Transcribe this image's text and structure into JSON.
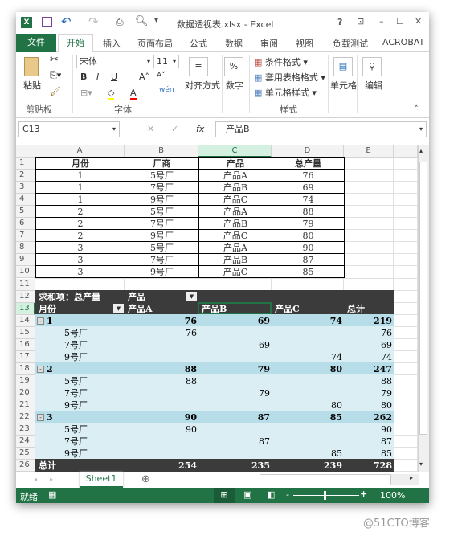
{
  "window": {
    "title": "数据透视表.xlsx - Excel",
    "help": "?",
    "minimize": "–",
    "maximize": "☐",
    "close": "✕"
  },
  "ribbon_tabs": [
    "文件",
    "开始",
    "插入",
    "页面布局",
    "公式",
    "数据",
    "审阅",
    "视图",
    "负载测试",
    "ACROBAT"
  ],
  "ribbon": {
    "paste": "粘贴",
    "clipboard_group": "剪贴板",
    "font_name": "宋体",
    "font_size": "11",
    "bold": "B",
    "italic": "I",
    "underline": "U",
    "font_group": "字体",
    "align": "对齐方式",
    "number": "数字",
    "number_icon": "%",
    "cond_format": "条件格式",
    "table_format": "套用表格格式",
    "cell_styles": "单元格样式",
    "styles_group": "样式",
    "cells": "单元格",
    "edit": "编辑",
    "colors": {
      "accent": "#217346",
      "highlight": "#ffff00",
      "font_color": "#ff0000"
    }
  },
  "formula_bar": {
    "name_box": "C13",
    "fx": "fx",
    "value": "产品B"
  },
  "columns": [
    "A",
    "B",
    "C",
    "D",
    "E"
  ],
  "selected_cell": "C13",
  "source_table": {
    "headers": [
      "月份",
      "厂商",
      "产品",
      "总产量"
    ],
    "rows": [
      [
        "1",
        "5号厂",
        "产品A",
        "76"
      ],
      [
        "1",
        "7号厂",
        "产品B",
        "69"
      ],
      [
        "1",
        "9号厂",
        "产品C",
        "74"
      ],
      [
        "2",
        "5号厂",
        "产品A",
        "88"
      ],
      [
        "2",
        "7号厂",
        "产品B",
        "79"
      ],
      [
        "2",
        "9号厂",
        "产品C",
        "80"
      ],
      [
        "3",
        "5号厂",
        "产品A",
        "90"
      ],
      [
        "3",
        "7号厂",
        "产品B",
        "87"
      ],
      [
        "3",
        "9号厂",
        "产品C",
        "85"
      ]
    ]
  },
  "pivot": {
    "title": "求和项：总产量",
    "col_field": "产品",
    "row_field": "月份",
    "col_headers": [
      "产品A",
      "产品B",
      "产品C",
      "总计"
    ],
    "rows": [
      {
        "type": "group",
        "label": "1",
        "values": [
          "76",
          "69",
          "74",
          "219"
        ]
      },
      {
        "type": "item",
        "label": "5号厂",
        "values": [
          "76",
          "",
          "",
          "76"
        ]
      },
      {
        "type": "item",
        "label": "7号厂",
        "values": [
          "",
          "69",
          "",
          "69"
        ]
      },
      {
        "type": "item",
        "label": "9号厂",
        "values": [
          "",
          "",
          "74",
          "74"
        ]
      },
      {
        "type": "group",
        "label": "2",
        "values": [
          "88",
          "79",
          "80",
          "247"
        ]
      },
      {
        "type": "item",
        "label": "5号厂",
        "values": [
          "88",
          "",
          "",
          "88"
        ]
      },
      {
        "type": "item",
        "label": "7号厂",
        "values": [
          "",
          "79",
          "",
          "79"
        ]
      },
      {
        "type": "item",
        "label": "9号厂",
        "values": [
          "",
          "",
          "80",
          "80"
        ]
      },
      {
        "type": "group",
        "label": "3",
        "values": [
          "90",
          "87",
          "85",
          "262"
        ]
      },
      {
        "type": "item",
        "label": "5号厂",
        "values": [
          "90",
          "",
          "",
          "90"
        ]
      },
      {
        "type": "item",
        "label": "7号厂",
        "values": [
          "",
          "87",
          "",
          "87"
        ]
      },
      {
        "type": "item",
        "label": "9号厂",
        "values": [
          "",
          "",
          "85",
          "85"
        ]
      },
      {
        "type": "total",
        "label": "总计",
        "values": [
          "254",
          "235",
          "239",
          "728"
        ]
      }
    ],
    "colors": {
      "header_bg": "#3b3b3b",
      "group_bg": "#b7dde8",
      "item_bg": "#daeef3"
    }
  },
  "sheet_tabs": [
    "Sheet1"
  ],
  "status": {
    "ready": "就绪",
    "zoom": "100%",
    "zoom_level": 100
  }
}
